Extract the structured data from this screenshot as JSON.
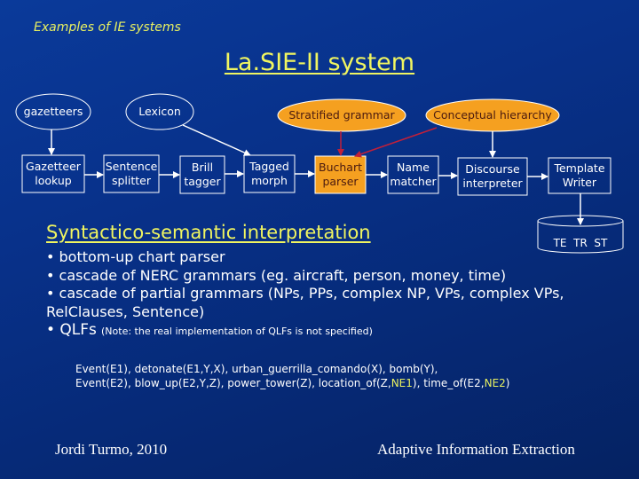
{
  "slide": {
    "subtitle": "Examples of IE systems",
    "title": "La.SIE-II system",
    "colors": {
      "background": "#08318a",
      "title": "#f0f560",
      "resource_fill": "#f5a020",
      "resource_arrow": "#b0203a",
      "text": "#ffffff"
    }
  },
  "diagram": {
    "resources": [
      {
        "id": "gazetteers",
        "label": "gazetteers",
        "style": "outline"
      },
      {
        "id": "lexicon",
        "label": "Lexicon",
        "style": "outline"
      },
      {
        "id": "stratified",
        "label": "Stratified grammar",
        "style": "filled"
      },
      {
        "id": "conceptual",
        "label": "Conceptual hierarchy",
        "style": "filled"
      }
    ],
    "modules": [
      {
        "id": "gaz",
        "label_lines": [
          "Gazetteer",
          "lookup"
        ],
        "style": "outline"
      },
      {
        "id": "sent",
        "label_lines": [
          "Sentence",
          "splitter"
        ],
        "style": "outline"
      },
      {
        "id": "brill",
        "label_lines": [
          "Brill",
          "tagger"
        ],
        "style": "outline"
      },
      {
        "id": "morph",
        "label_lines": [
          "Tagged",
          "morph"
        ],
        "style": "outline"
      },
      {
        "id": "buchart",
        "label_lines": [
          "Buchart",
          "parser"
        ],
        "style": "filled"
      },
      {
        "id": "name",
        "label_lines": [
          "Name",
          "matcher"
        ],
        "style": "outline"
      },
      {
        "id": "disc",
        "label_lines": [
          "Discourse",
          "interpreter"
        ],
        "style": "outline"
      },
      {
        "id": "tmpl",
        "label_lines": [
          "Template",
          "Writer"
        ],
        "style": "outline"
      }
    ],
    "output_store": {
      "label": "TE  TR  ST"
    },
    "edges": [
      [
        "gazetteers",
        "gaz"
      ],
      [
        "lexicon",
        "morph"
      ],
      [
        "stratified",
        "buchart"
      ],
      [
        "conceptual",
        "buchart"
      ],
      [
        "conceptual",
        "disc"
      ],
      [
        "gaz",
        "sent"
      ],
      [
        "sent",
        "brill"
      ],
      [
        "brill",
        "morph"
      ],
      [
        "morph",
        "buchart"
      ],
      [
        "buchart",
        "name"
      ],
      [
        "name",
        "disc"
      ],
      [
        "disc",
        "tmpl"
      ],
      [
        "tmpl",
        "store"
      ]
    ]
  },
  "section": {
    "title": "Syntactico-semantic interpretation",
    "bullets": [
      "• bottom-up chart parser",
      "• cascade of NERC grammars (eg. aircraft, person, money, time)",
      "• cascade of partial grammars (NPs, PPs, complex NP, VPs, complex VPs,",
      "RelClauses, Sentence)"
    ],
    "qlf_label": "• QLFs",
    "qlf_note": "(Note: the real implementation of QLFs is not specified)"
  },
  "example": {
    "line1": "Event(E1), detonate(E1,Y,X), urban_guerrilla_comando(X), bomb(Y),",
    "line2_a": "Event(E2), blow_up(E2,Y,Z), power_tower(Z), location_of(Z,",
    "line2_ne1": "NE1",
    "line2_b": "), time_of(E2,",
    "line2_ne2": "NE2",
    "line2_c": ")"
  },
  "footer": {
    "left": "Jordi Turmo, 2010",
    "right": "Adaptive Information Extraction"
  }
}
